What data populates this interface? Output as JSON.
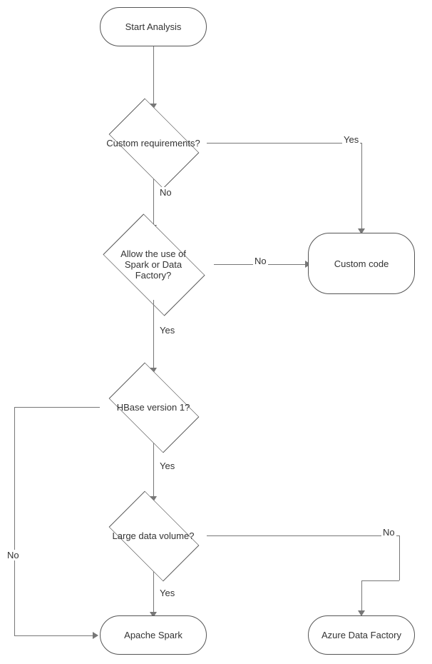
{
  "nodes": {
    "start": "Start Analysis",
    "decision1": "Custom requirements?",
    "decision2": "Allow the use of Spark or Data Factory?",
    "decision3": "HBase version 1?",
    "decision4": "Large data volume?",
    "terminal_custom": "Custom code",
    "terminal_spark": "Apache Spark",
    "terminal_adf": "Azure Data Factory"
  },
  "labels": {
    "yes": "Yes",
    "no": "No"
  }
}
